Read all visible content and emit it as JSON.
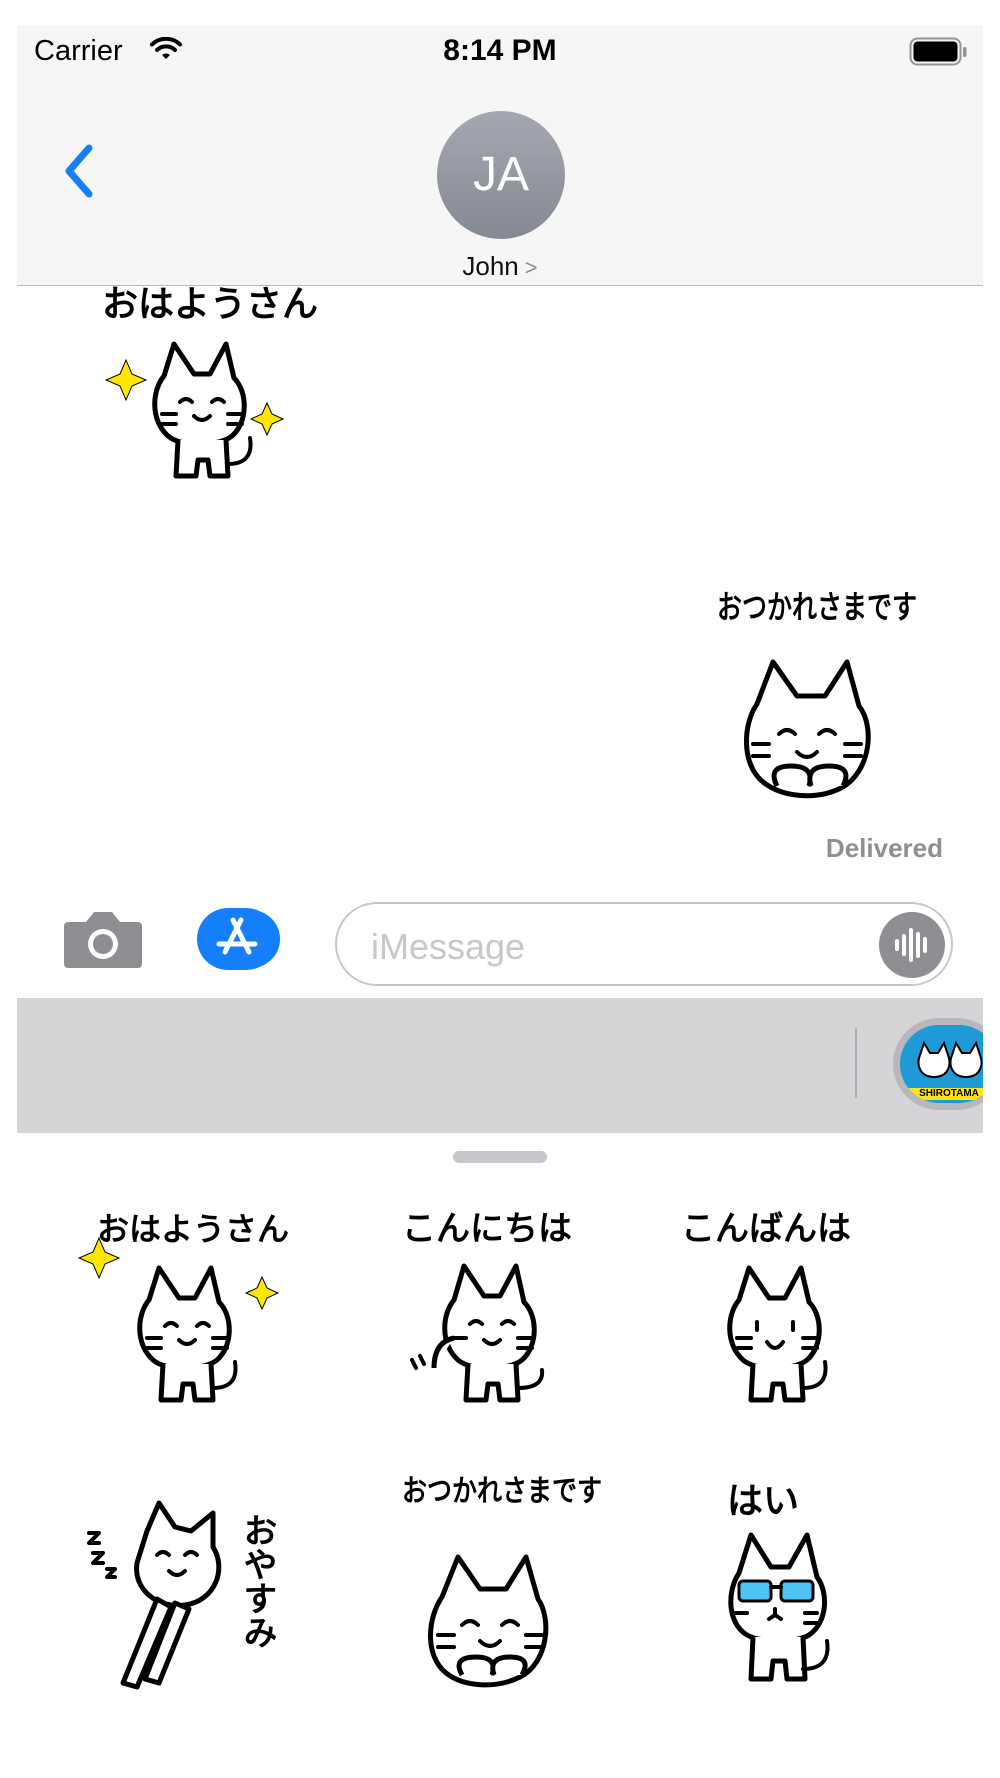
{
  "status": {
    "carrier": "Carrier",
    "time": "8:14 PM"
  },
  "header": {
    "avatar_initials": "JA",
    "contact_name": "John",
    "chevron": ">"
  },
  "thread": {
    "incoming_sticker": {
      "text": "おはようさん"
    },
    "outgoing_sticker": {
      "text": "おつかれさまです"
    },
    "status": "Delivered"
  },
  "composer": {
    "placeholder": "iMessage"
  },
  "drawer": {
    "app_label": "SHIROTAMA"
  },
  "stickers": [
    {
      "text": "おはようさん"
    },
    {
      "text": "こんにちは"
    },
    {
      "text": "こんばんは"
    },
    {
      "text": "おやすみ"
    },
    {
      "text": "おつかれさまです"
    },
    {
      "text": "はい"
    }
  ],
  "colors": {
    "accent": "#147efb",
    "sparkle": "#ffe600",
    "sunglasses": "#4fc3f7"
  }
}
